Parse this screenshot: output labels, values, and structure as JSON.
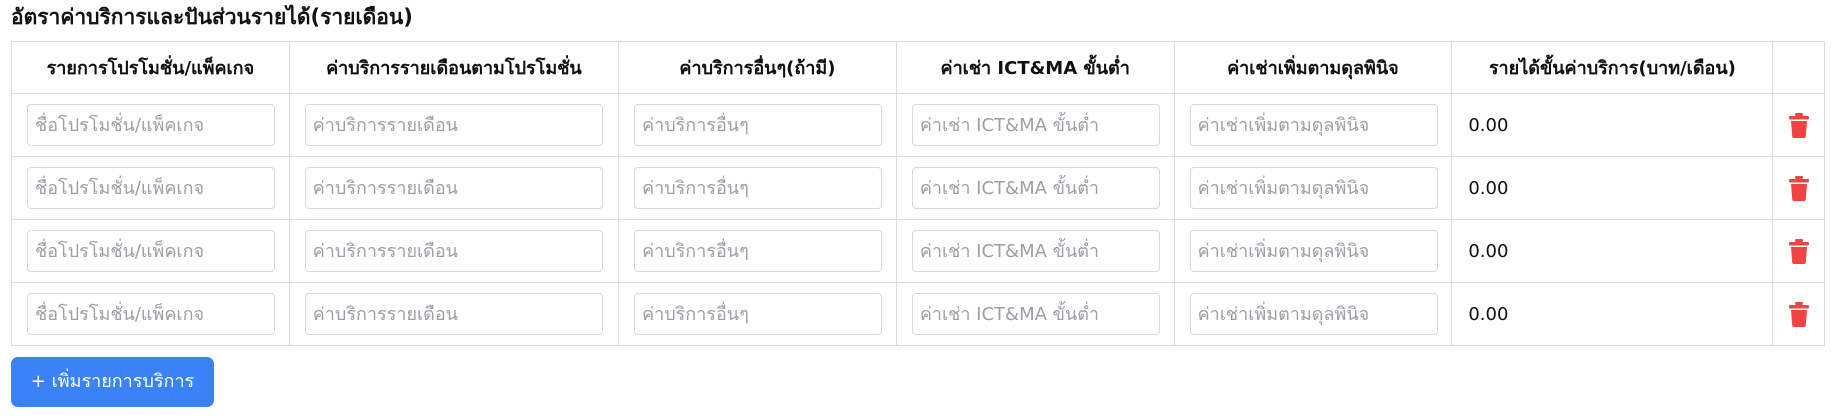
{
  "section": {
    "title": "อัตราค่าบริการและปันส่วนรายได้(รายเดือน)"
  },
  "table": {
    "headers": [
      "รายการโปรโมชั่น/แพ็คเกจ",
      "ค่าบริการรายเดือนตามโปรโมชั่น",
      "ค่าบริการอื่นๆ(ถ้ามี)",
      "ค่าเช่า ICT&MA ขั้นต่ำ",
      "ค่าเช่าเพิ่มตามดุลพินิจ",
      "รายได้ขั้นค่าบริการ(บาท/เดือน)",
      ""
    ],
    "placeholders": {
      "promo": "ชื่อโปรโมชั่น/แพ็คเกจ",
      "monthly": "ค่าบริการรายเดือน",
      "other": "ค่าบริการอื่นๆ",
      "ict": "ค่าเช่า ICT&MA ขั้นต่ำ",
      "extra": "ค่าเช่าเพิ่มตามดุลพินิจ"
    },
    "rows": [
      {
        "promo": "",
        "monthly": "",
        "other": "",
        "ict": "",
        "extra": "",
        "min_revenue": "0.00"
      },
      {
        "promo": "",
        "monthly": "",
        "other": "",
        "ict": "",
        "extra": "",
        "min_revenue": "0.00"
      },
      {
        "promo": "",
        "monthly": "",
        "other": "",
        "ict": "",
        "extra": "",
        "min_revenue": "0.00"
      },
      {
        "promo": "",
        "monthly": "",
        "other": "",
        "ict": "",
        "extra": "",
        "min_revenue": "0.00"
      }
    ],
    "delete_icon": "trash-icon"
  },
  "actions": {
    "add_service_label": "+ เพิ่มรายการบริการ"
  },
  "colors": {
    "accent": "#3b82f6",
    "danger": "#ef4444",
    "border": "#dcdcdc",
    "placeholder": "#9aa0a6"
  }
}
